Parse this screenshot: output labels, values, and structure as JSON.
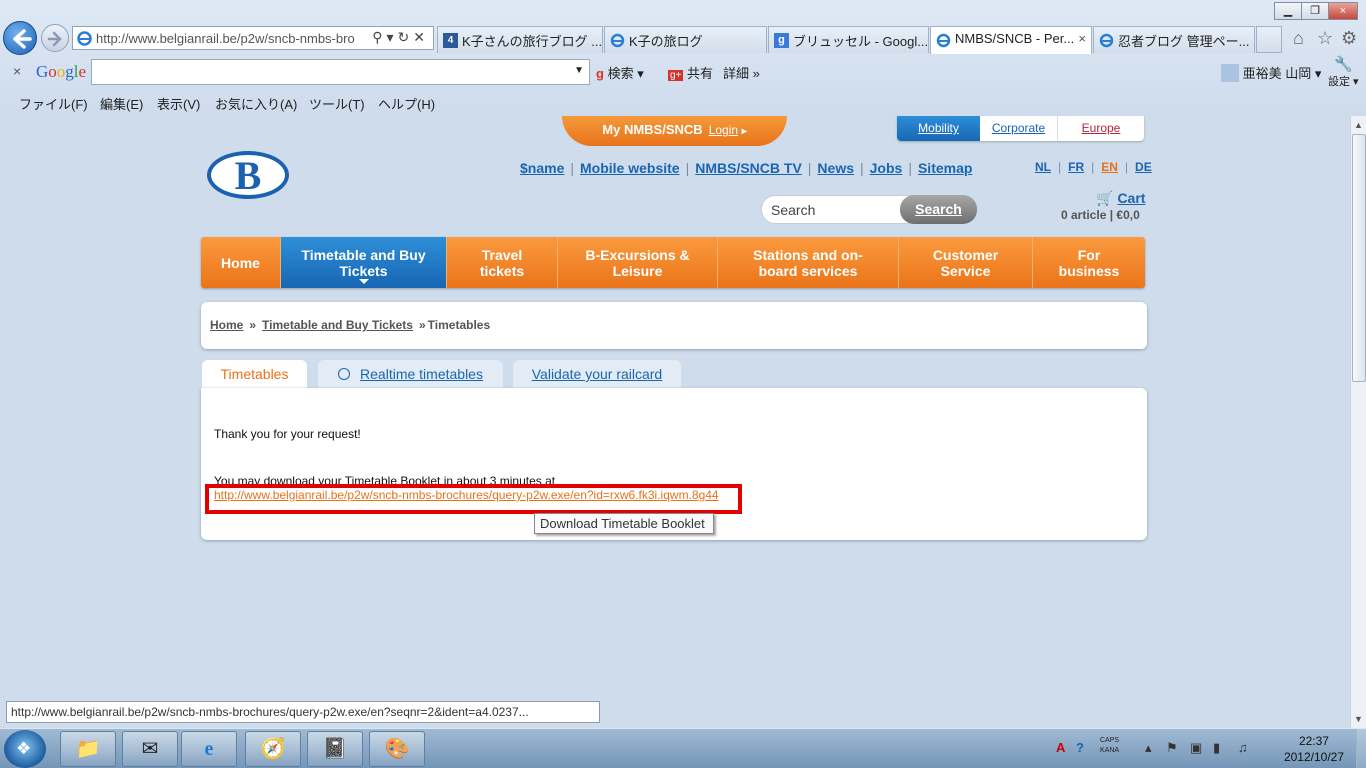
{
  "browser": {
    "address_url": "http://www.belgianrail.be/p2w/sncb-nmbs-bro",
    "tabs": [
      {
        "label": "K子さんの旅行ブログ ..."
      },
      {
        "label": "K子の旅ログ"
      },
      {
        "label": "ブリュッセル - Googl..."
      },
      {
        "label": "NMBS/SNCB - Per..."
      },
      {
        "label": "忍者ブログ 管理ペー..."
      }
    ],
    "close_glyph": "×",
    "google_label": "Google",
    "google_buttons": {
      "search": "検索",
      "share": "共有",
      "more": "詳細"
    },
    "user_name": "亜裕美 山岡",
    "settings_label": "設定",
    "menus": [
      "ファイル(F)",
      "編集(E)",
      "表示(V)",
      "お気に入り(A)",
      "ツール(T)",
      "ヘルプ(H)"
    ],
    "status_url": "http://www.belgianrail.be/p2w/sncb-nmbs-brochures/query-p2w.exe/en?seqnr=2&ident=a4.0237..."
  },
  "site": {
    "my_nmbs": "My NMBS/SNCB",
    "login": "Login",
    "switch": {
      "mobility": "Mobility",
      "corporate": "Corporate",
      "europe": "Europe"
    },
    "logo_letter": "B",
    "top_links": [
      "$name",
      "Mobile website",
      "NMBS/SNCB TV",
      "News",
      "Jobs",
      "Sitemap"
    ],
    "languages": [
      "NL",
      "FR",
      "EN",
      "DE"
    ],
    "active_language": "EN",
    "search_placeholder": "Search",
    "search_button": "Search",
    "cart_label": "Cart",
    "cart_info": "0 article | €0,0",
    "nav": [
      {
        "label": "Home"
      },
      {
        "label": "Timetable and Buy Tickets"
      },
      {
        "label": "Travel tickets"
      },
      {
        "label": "B-Excursions & Leisure"
      },
      {
        "label": "Stations and on-board services"
      },
      {
        "label": "Customer Service"
      },
      {
        "label": "For business"
      }
    ],
    "breadcrumb": {
      "home": "Home",
      "section": "Timetable and Buy Tickets",
      "current": "Timetables"
    },
    "page_tabs": {
      "timetables": "Timetables",
      "realtime": "Realtime timetables",
      "railcard": "Validate your railcard"
    },
    "content": {
      "thanks": "Thank you for your request!",
      "may_download": "You may download your Timetable Booklet in about 3 minutes at",
      "download_link": "http://www.belgianrail.be/p2w/sncb-nmbs-brochures/query-p2w.exe/en?id=rxw6.fk3i.iqwm.8g44",
      "tooltip": "Download Timetable Booklet"
    }
  },
  "taskbar": {
    "caps": "CAPS",
    "kana": "KANA",
    "time": "22:37",
    "date": "2012/10/27"
  },
  "colors": {
    "orange": "#e8721a",
    "blue": "#1a65b2",
    "highlight": "#e30000"
  }
}
